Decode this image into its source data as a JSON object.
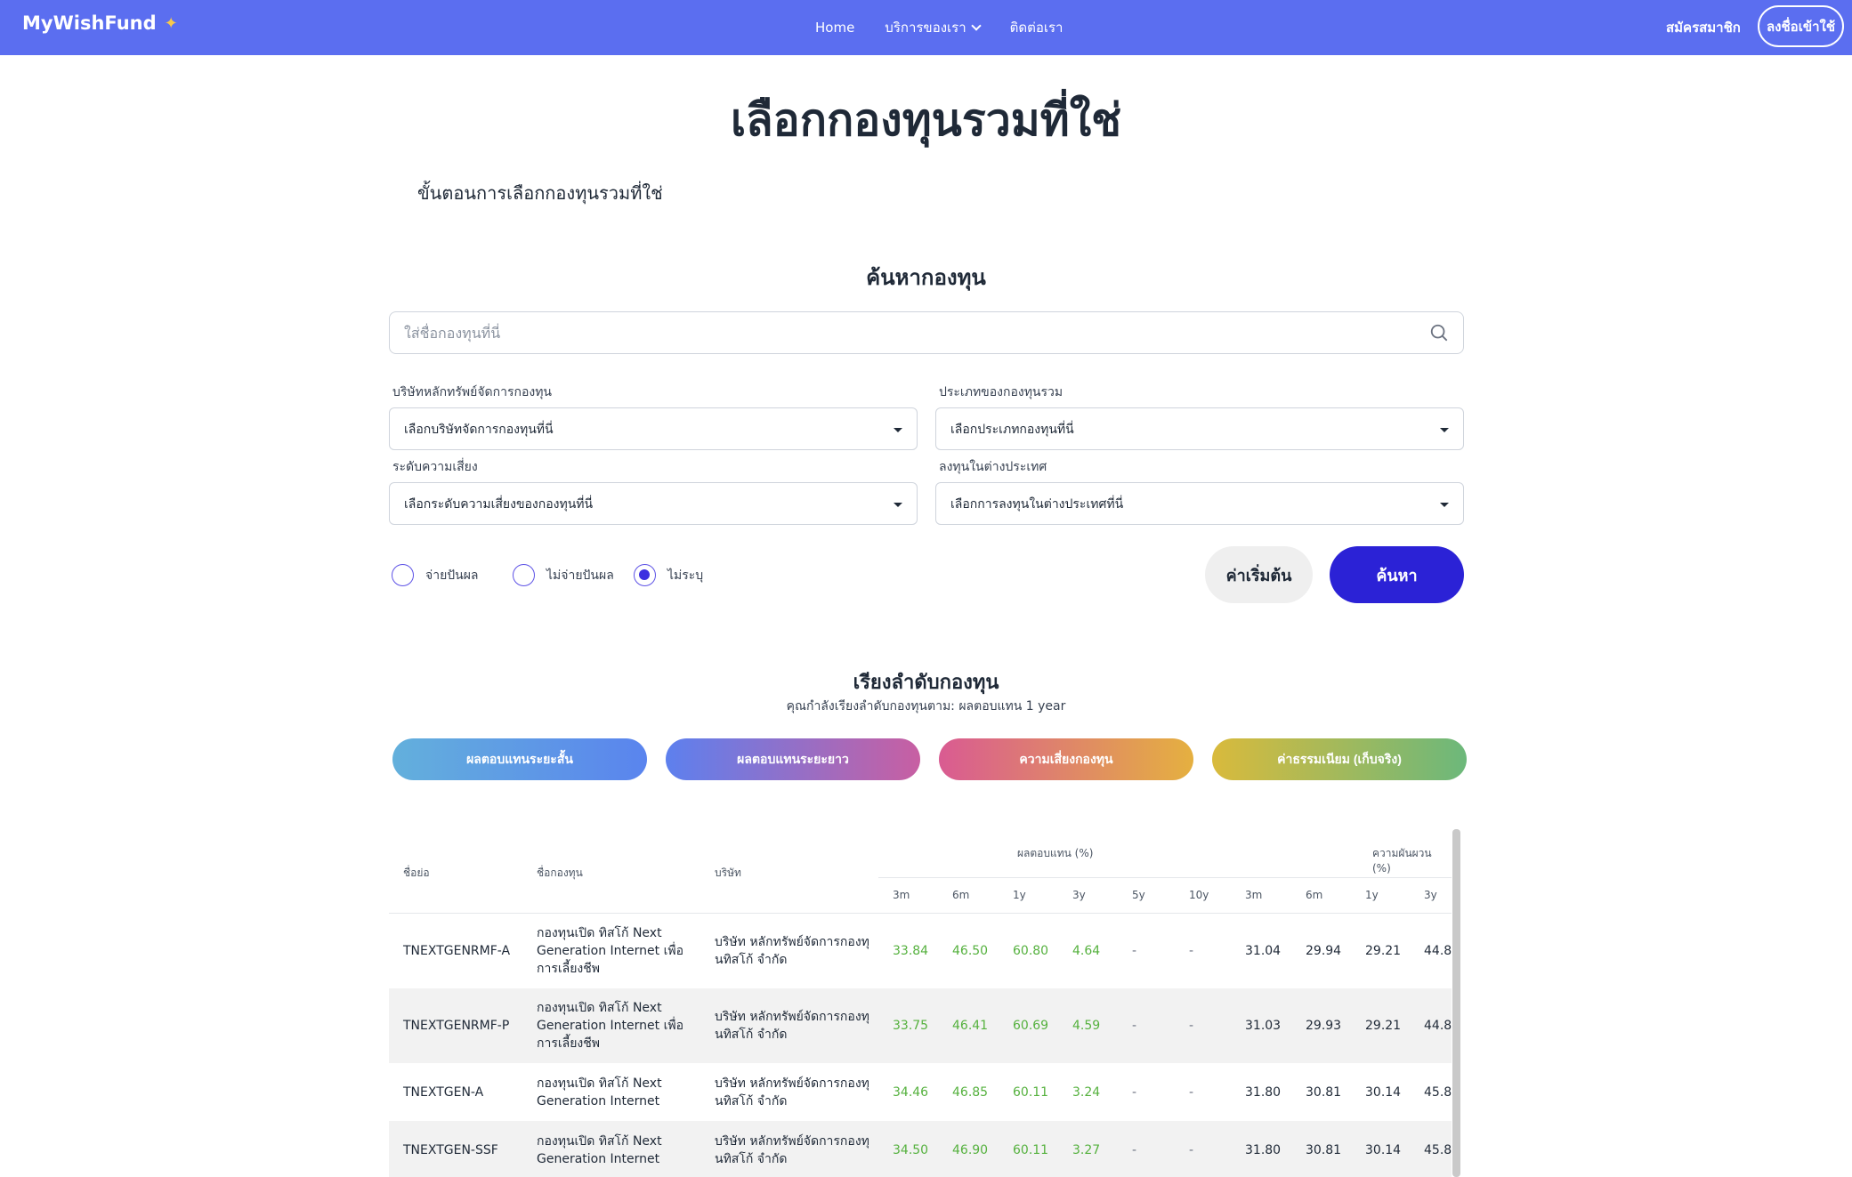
{
  "nav": {
    "brand": "MyWishFund",
    "brand_icon": "sparkle-icon",
    "links": [
      "Home",
      "บริการของเรา",
      "ติดต่อเรา"
    ],
    "signup": "สมัครสมาชิก",
    "login": "ลงชื่อเข้าใช้"
  },
  "page": {
    "title": "เลือกกองทุนรวมที่ใช่",
    "subtitle": "ขั้นตอนการเลือกกองทุนรวมที่ใช่"
  },
  "search": {
    "heading": "ค้นหากองทุน",
    "placeholder": "ใส่ชื่อกองทุนที่นี่",
    "value": ""
  },
  "filters": {
    "company_label": "บริษัทหลักทรัพย์จัดการกองทุน",
    "company_value": "เลือกบริษัทจัดการกองทุนที่นี่",
    "type_label": "ประเภทของกองทุนรวม",
    "type_value": "เลือกประเภทกองทุนที่นี่",
    "risk_label": "ระดับความเสี่ยง",
    "risk_value": "เลือกระดับความเสี่ยงของกองทุนที่นี่",
    "foreign_label": "ลงทุนในต่างประเทศ",
    "foreign_value": "เลือกการลงทุนในต่างประเทศที่นี่",
    "dividend_options": [
      "จ่ายปันผล",
      "ไม่จ่ายปันผล",
      "ไม่ระบุ"
    ],
    "dividend_selected": "ไม่ระบุ",
    "reset_label": "ค่าเริ่มต้น",
    "search_label": "ค้นหา"
  },
  "ranking": {
    "heading": "เรียงลำดับกองทุน",
    "sub": "คุณกำลังเรียงลำดับกองทุนตาม: ผลตอบแทน 1 year",
    "tabs": [
      "ผลตอบแทนระยะสั้น",
      "ผลตอบแทนระยะยาว",
      "ความเสี่ยงกองทุน",
      "ค่าธรรมเนียม (เก็บจริง)"
    ]
  },
  "table": {
    "col_short": "ชื่อย่อ",
    "col_name": "ชื่อกองทุน",
    "col_company": "บริษัท",
    "group_return": "ผลตอบแทน (%)",
    "group_volatility": "ความผันผวน (%)",
    "return_periods": [
      "3m",
      "6m",
      "1y",
      "3y",
      "5y",
      "10y"
    ],
    "volatility_periods": [
      "3m",
      "6m",
      "1y",
      "3y"
    ],
    "rows": [
      {
        "short": "TNEXTGENRMF-A",
        "name": [
          "กองทุนเปิด ทิสโก้ Next",
          "Generation Internet เพื่อ",
          "การเลี้ยงชีพ"
        ],
        "company": [
          "บริษัท หลักทรัพย์จัดการกองทุ",
          "นทิสโก้ จำกัด"
        ],
        "returns": [
          "33.84",
          "46.50",
          "60.80",
          "4.64",
          "-",
          "-"
        ],
        "volatility": [
          "31.04",
          "29.94",
          "29.21",
          "44.8"
        ]
      },
      {
        "short": "TNEXTGENRMF-P",
        "name": [
          "กองทุนเปิด ทิสโก้ Next",
          "Generation Internet เพื่อ",
          "การเลี้ยงชีพ"
        ],
        "company": [
          "บริษัท หลักทรัพย์จัดการกองทุ",
          "นทิสโก้ จำกัด"
        ],
        "returns": [
          "33.75",
          "46.41",
          "60.69",
          "4.59",
          "-",
          "-"
        ],
        "volatility": [
          "31.03",
          "29.93",
          "29.21",
          "44.8"
        ]
      },
      {
        "short": "TNEXTGEN-A",
        "name": [
          "กองทุนเปิด ทิสโก้ Next",
          "Generation Internet"
        ],
        "company": [
          "บริษัท หลักทรัพย์จัดการกองทุ",
          "นทิสโก้ จำกัด"
        ],
        "returns": [
          "34.46",
          "46.85",
          "60.11",
          "3.24",
          "-",
          "-"
        ],
        "volatility": [
          "31.80",
          "30.81",
          "30.14",
          "45.8"
        ]
      },
      {
        "short": "TNEXTGEN-SSF",
        "name": [
          "กองทุนเปิด ทิสโก้ Next",
          "Generation Internet"
        ],
        "company": [
          "บริษัท หลักทรัพย์จัดการกองทุ",
          "นทิสโก้ จำกัด"
        ],
        "returns": [
          "34.50",
          "46.90",
          "60.11",
          "3.27",
          "-",
          "-"
        ],
        "volatility": [
          "31.80",
          "30.81",
          "30.14",
          "45.8"
        ]
      }
    ]
  }
}
